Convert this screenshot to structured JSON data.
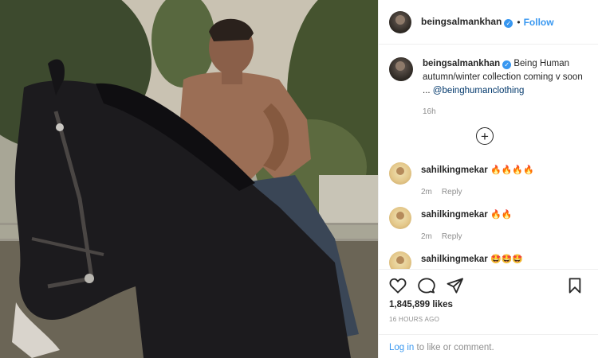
{
  "post": {
    "username": "beingsalmankhan",
    "verified_mark": "✓",
    "separator": "•",
    "follow_label": "Follow"
  },
  "caption": {
    "username": "beingsalmankhan",
    "text": "Being Human autumn/winter collection coming v soon ... ",
    "mention": "@beinghumanclothing",
    "time": "16h"
  },
  "load_more_icon": "+",
  "comments": [
    {
      "username": "sahilkingmekar",
      "text": "🔥🔥🔥🔥",
      "time": "2m",
      "reply_label": "Reply"
    },
    {
      "username": "sahilkingmekar",
      "text": "🔥🔥",
      "time": "2m",
      "reply_label": "Reply"
    },
    {
      "username": "sahilkingmekar",
      "text": "🤩🤩🤩",
      "time": "",
      "reply_label": ""
    }
  ],
  "icons": {
    "like": "heart-icon",
    "comment": "comment-bubble-icon",
    "share": "paper-plane-icon",
    "save": "bookmark-icon"
  },
  "stats": {
    "likes": "1,845,899 likes",
    "ago": "16 HOURS AGO"
  },
  "login": {
    "link": "Log in",
    "rest": " to like or comment."
  }
}
